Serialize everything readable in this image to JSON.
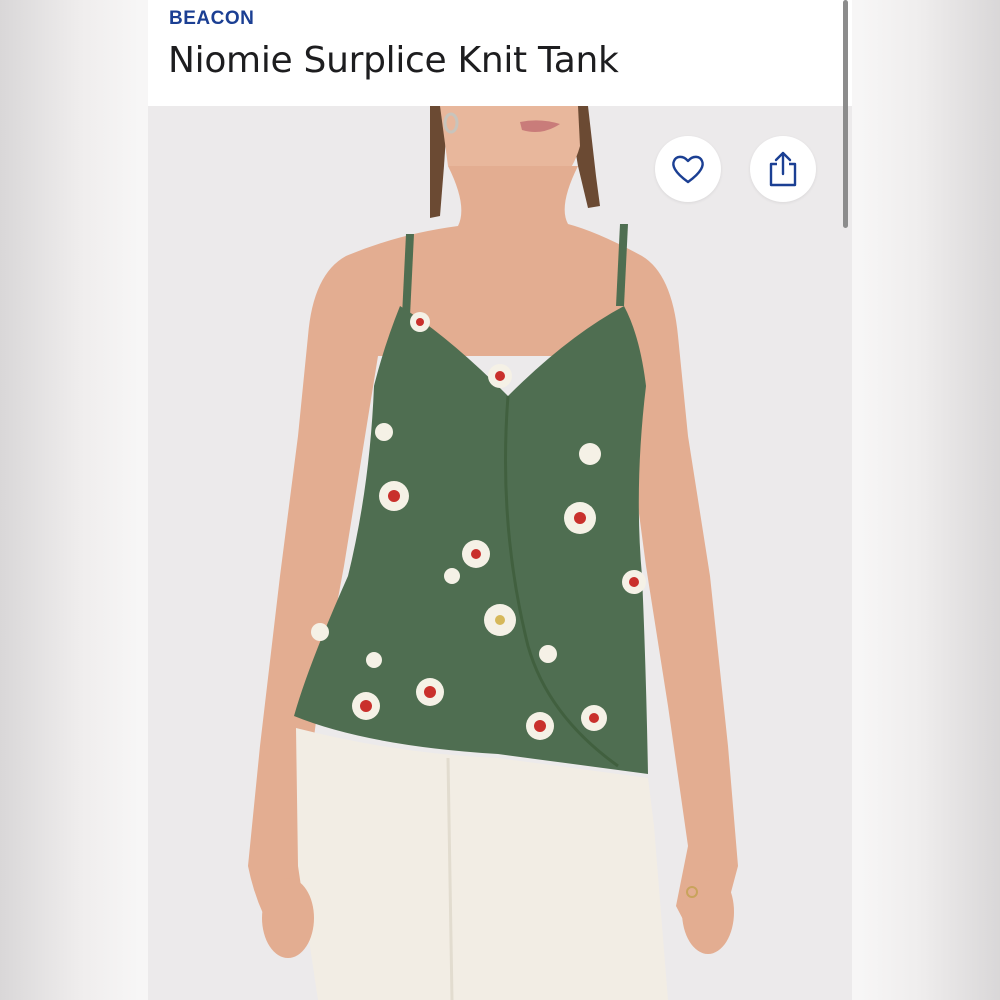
{
  "product": {
    "brand": "BEACON",
    "name": "Niomie Surplice Knit Tank"
  },
  "actions": {
    "favorite_icon": "heart-icon",
    "share_icon": "share-icon"
  },
  "colors": {
    "brand": "#1b3f93",
    "top_green": "#4f6e51",
    "pants": "#f2ede4",
    "background": "#e9e9eb"
  }
}
